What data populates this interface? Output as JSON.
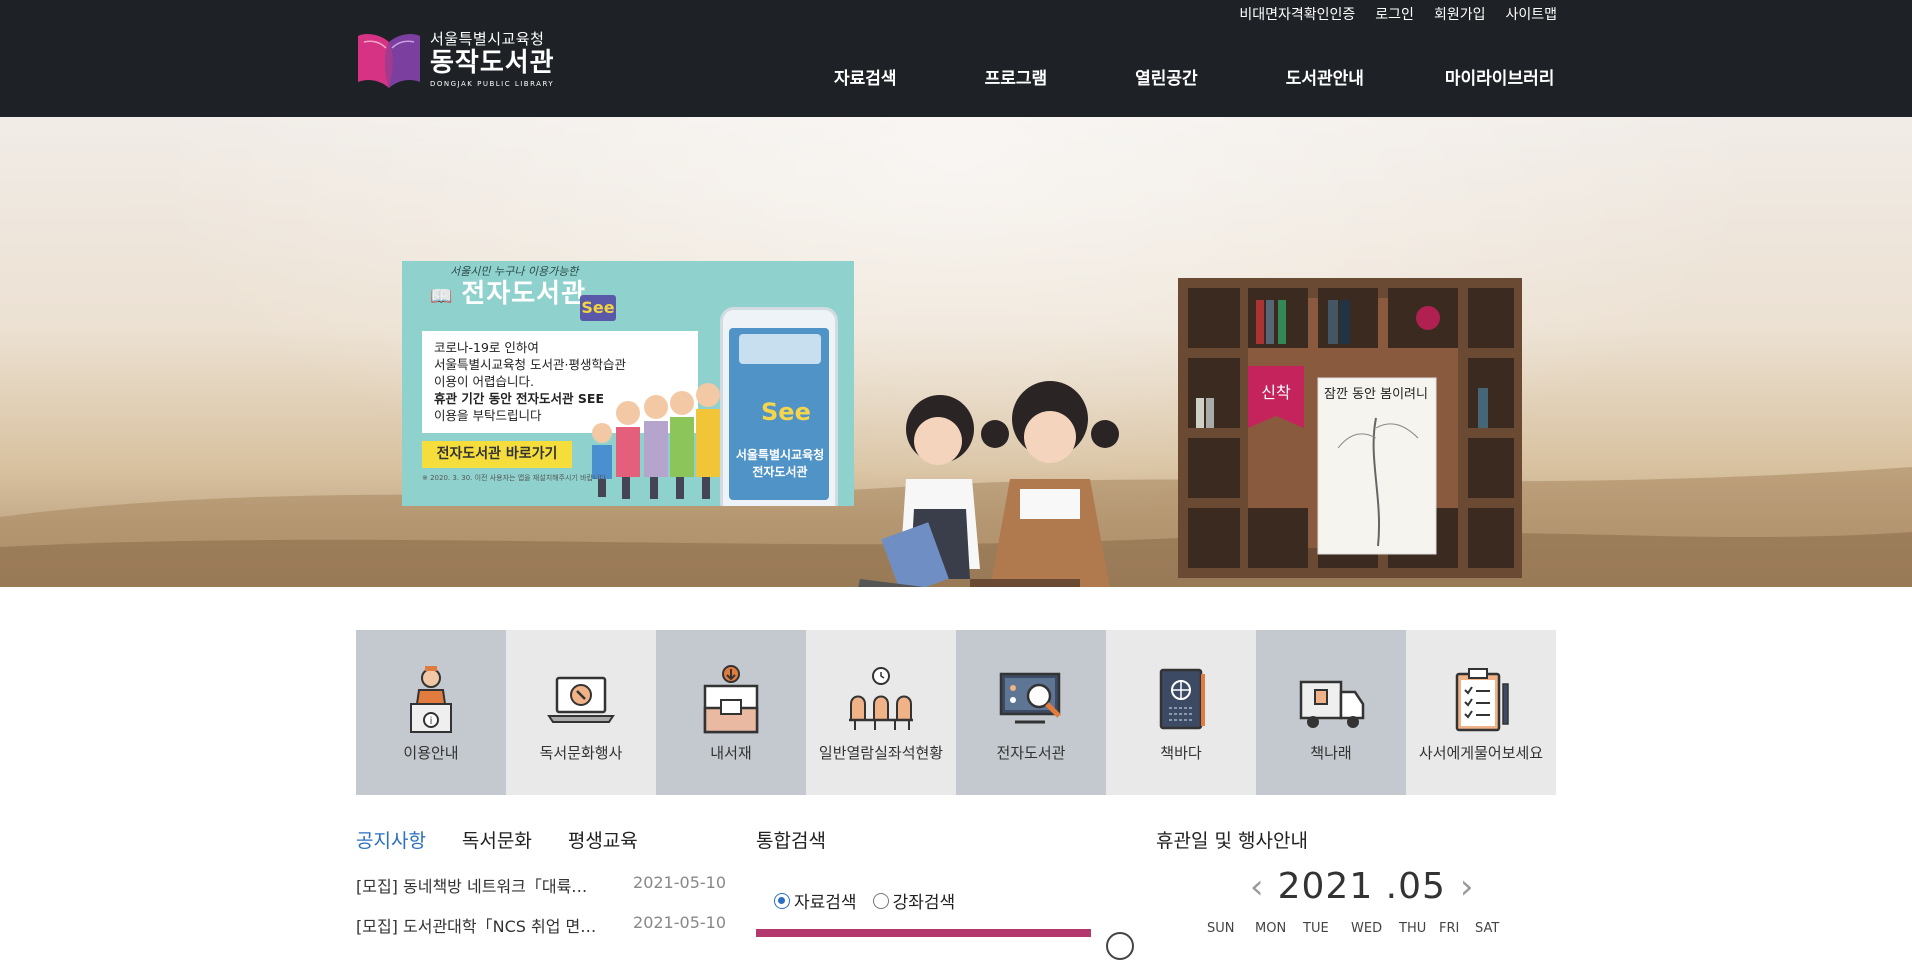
{
  "util_links": [
    "비대면자격확인인증",
    "로그인",
    "회원가입",
    "사이트맵"
  ],
  "logo": {
    "sub": "서울특별시교육청",
    "main": "동작도서관",
    "eng": "DONGJAK PUBLIC LIBRARY"
  },
  "gnb": [
    "자료검색",
    "프로그램",
    "열린공간",
    "도서관안내",
    "마이라이브러리"
  ],
  "banner": {
    "script": "서울시민 누구나 이용가능한",
    "title": "전자도서관",
    "tag": "See",
    "lines": [
      "코로나-19로 인하여",
      "서울특별시교육청 도서관·평생학습관",
      "이용이 어렵습니다.",
      "휴관 기간 동안 전자도서관 SEE",
      "이용을 부탁드립니다"
    ],
    "button": "전자도서관 바로가기",
    "note": "※ 2020. 3. 30. 이전 사용자는 앱을 재설치해주시기 바랍니다",
    "phone_text": "서울특별시교육청 전자도서관",
    "phone_brand": "See"
  },
  "slider": {
    "count": 5,
    "active_index": 2
  },
  "hero_book": {
    "badge": "신착",
    "title": "잠깐 동안 봄이려니"
  },
  "quick_menu": [
    {
      "label": "이용안내",
      "icon": "librarian-desk-icon",
      "tone": "dark"
    },
    {
      "label": "독서문화행사",
      "icon": "laptop-event-icon",
      "tone": "light"
    },
    {
      "label": "내서재",
      "icon": "bookshelf-download-icon",
      "tone": "dark"
    },
    {
      "label": "일반열람실좌석현황",
      "icon": "reading-room-seats-icon",
      "tone": "light"
    },
    {
      "label": "전자도서관",
      "icon": "e-library-screen-icon",
      "tone": "dark"
    },
    {
      "label": "책바다",
      "icon": "globe-book-icon",
      "tone": "light"
    },
    {
      "label": "책나래",
      "icon": "delivery-truck-icon",
      "tone": "dark"
    },
    {
      "label": "사서에게물어보세요",
      "icon": "clipboard-checklist-icon",
      "tone": "light"
    }
  ],
  "notice": {
    "tabs": [
      "공지사항",
      "독서문화",
      "평생교육"
    ],
    "items": [
      {
        "title": "[모집] 동네책방 네트워크「대륙…",
        "date": "2021-05-10"
      },
      {
        "title": "[모집] 도서관대학「NCS 취업 면…",
        "date": "2021-05-10"
      }
    ]
  },
  "search": {
    "title": "통합검색",
    "options": [
      "자료검색",
      "강좌검색"
    ],
    "selected": "자료검색"
  },
  "calendar": {
    "title": "휴관일 및 행사안내",
    "year_month": "2021 .05",
    "days": [
      "SUN",
      "MON",
      "TUE",
      "WED",
      "THU",
      "FRI",
      "SAT"
    ]
  },
  "colors": {
    "header_bg": "#1e2226",
    "accent_blue": "#2a6fc2",
    "search_bar": "#b2386d"
  }
}
